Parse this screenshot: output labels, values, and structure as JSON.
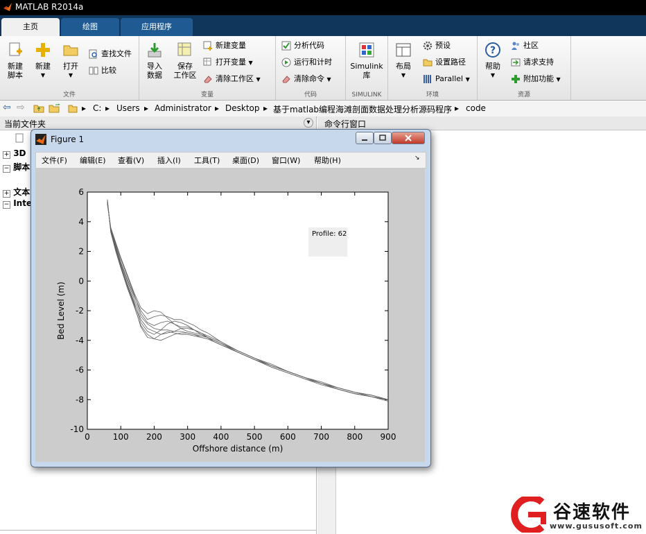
{
  "window": {
    "title": "MATLAB R2014a"
  },
  "tabs": [
    {
      "label": "主页",
      "active": true
    },
    {
      "label": "绘图",
      "active": false
    },
    {
      "label": "应用程序",
      "active": false
    }
  ],
  "ribbon": {
    "file": {
      "section_label": "文件",
      "new_script": "新建\n脚本",
      "new": "新建",
      "open": "打开",
      "find_files": "查找文件",
      "compare": "比较"
    },
    "variable": {
      "section_label": "变量",
      "import": "导入\n数据",
      "save_ws": "保存\n工作区",
      "new_var": "新建变量",
      "open_var": "打开变量",
      "clear_ws": "清除工作区"
    },
    "code": {
      "section_label": "代码",
      "analyze": "分析代码",
      "run_time": "运行和计时",
      "clear_cmd": "清除命令"
    },
    "simulink": {
      "section_label": "SIMULINK",
      "lib": "Simulink\n库"
    },
    "environment": {
      "section_label": "环境",
      "layout": "布局",
      "prefs": "预设",
      "set_path": "设置路径",
      "parallel": "Parallel"
    },
    "resources": {
      "section_label": "资源",
      "help": "帮助",
      "community": "社区",
      "request": "请求支持",
      "addons": "附加功能"
    }
  },
  "address": [
    "C:",
    "Users",
    "Administrator",
    "Desktop",
    "基于matlab编程海滩剖面数据处理分析源码程序",
    "code"
  ],
  "left_panel": {
    "header": "当前文件夹",
    "items": [
      {
        "sign": "+",
        "label": "3D"
      },
      {
        "sign": "−",
        "label": "脚本"
      },
      {
        "sign": "+",
        "label": "文本"
      },
      {
        "sign": "−",
        "label": "Inte"
      }
    ]
  },
  "right_panel": {
    "header": "命令行窗口"
  },
  "figure": {
    "title": "Figure 1",
    "menu": [
      "文件(F)",
      "编辑(E)",
      "查看(V)",
      "插入(I)",
      "工具(T)",
      "桌面(D)",
      "窗口(W)",
      "帮助(H)"
    ],
    "annotation": "Profile: 62"
  },
  "chart_data": {
    "type": "line",
    "xlabel": "Offshore distance (m)",
    "ylabel": "Bed Level (m)",
    "xlim": [
      0,
      900
    ],
    "ylim": [
      -10,
      6
    ],
    "xticks": [
      0,
      100,
      200,
      300,
      400,
      500,
      600,
      700,
      800,
      900
    ],
    "yticks": [
      -10,
      -8,
      -6,
      -4,
      -2,
      0,
      2,
      4,
      6
    ],
    "grid": false,
    "line_color": "#606060",
    "series": [
      {
        "x": [
          60,
          70,
          85,
          100,
          120,
          140,
          160,
          180,
          200,
          220,
          240,
          260,
          280,
          300,
          320,
          340,
          360,
          380,
          400,
          450,
          500,
          550,
          600,
          650,
          700,
          750,
          800,
          850,
          900
        ],
        "y": [
          5.3,
          3.5,
          2.3,
          1.2,
          0.0,
          -1.2,
          -2.4,
          -2.9,
          -3.2,
          -3.3,
          -3.3,
          -3.4,
          -3.4,
          -3.5,
          -3.6,
          -3.7,
          -3.8,
          -4.0,
          -4.2,
          -4.7,
          -5.2,
          -5.7,
          -6.1,
          -6.5,
          -6.9,
          -7.2,
          -7.5,
          -7.7,
          -8.0
        ]
      },
      {
        "x": [
          60,
          70,
          85,
          100,
          120,
          140,
          160,
          180,
          200,
          220,
          240,
          260,
          280,
          300,
          320,
          340,
          360,
          380,
          400,
          450,
          500,
          550,
          600,
          650,
          700,
          750,
          800,
          850,
          900
        ],
        "y": [
          5.4,
          3.4,
          2.1,
          1.0,
          -0.3,
          -1.5,
          -2.6,
          -3.2,
          -3.4,
          -3.6,
          -3.5,
          -3.4,
          -3.2,
          -3.2,
          -3.3,
          -3.5,
          -3.7,
          -3.9,
          -4.1,
          -4.7,
          -5.2,
          -5.7,
          -6.1,
          -6.5,
          -6.9,
          -7.3,
          -7.6,
          -7.8,
          -8.0
        ]
      },
      {
        "x": [
          60,
          70,
          85,
          100,
          120,
          140,
          160,
          180,
          200,
          220,
          240,
          260,
          280,
          300,
          320,
          340,
          360,
          380,
          400,
          450,
          500,
          550,
          600,
          650,
          700,
          750,
          800,
          850,
          900
        ],
        "y": [
          5.2,
          3.6,
          2.6,
          1.6,
          0.4,
          -0.8,
          -1.8,
          -2.2,
          -2.0,
          -2.1,
          -2.5,
          -2.9,
          -3.1,
          -3.1,
          -3.3,
          -3.5,
          -3.8,
          -4.1,
          -4.3,
          -4.8,
          -5.3,
          -5.7,
          -6.1,
          -6.5,
          -6.9,
          -7.2,
          -7.5,
          -7.8,
          -8.0
        ]
      },
      {
        "x": [
          60,
          70,
          85,
          100,
          120,
          140,
          160,
          180,
          200,
          220,
          240,
          260,
          280,
          300,
          320,
          340,
          360,
          380,
          400,
          450,
          500,
          550,
          600,
          650,
          700,
          750,
          800,
          850,
          900
        ],
        "y": [
          5.5,
          3.3,
          2.0,
          0.9,
          -0.5,
          -1.7,
          -3.0,
          -3.6,
          -3.9,
          -4.0,
          -3.8,
          -3.6,
          -3.5,
          -3.5,
          -3.6,
          -3.8,
          -3.9,
          -4.1,
          -4.3,
          -4.8,
          -5.3,
          -5.8,
          -6.2,
          -6.6,
          -6.9,
          -7.3,
          -7.6,
          -7.8,
          -8.1
        ]
      },
      {
        "x": [
          60,
          70,
          85,
          100,
          120,
          140,
          160,
          180,
          200,
          220,
          240,
          260,
          280,
          300,
          320,
          340,
          360,
          380,
          400,
          450,
          500,
          550,
          600,
          650,
          700,
          750,
          800,
          850,
          900
        ],
        "y": [
          5.3,
          3.5,
          2.4,
          1.3,
          0.1,
          -1.0,
          -2.0,
          -2.6,
          -2.4,
          -2.3,
          -2.4,
          -2.6,
          -2.6,
          -2.8,
          -3.0,
          -3.3,
          -3.5,
          -3.8,
          -4.1,
          -4.7,
          -5.2,
          -5.6,
          -6.1,
          -6.5,
          -6.8,
          -7.2,
          -7.5,
          -7.7,
          -8.0
        ]
      },
      {
        "x": [
          60,
          70,
          85,
          100,
          120,
          140,
          160,
          180,
          200,
          220,
          240,
          260,
          280,
          300,
          320,
          340,
          360,
          380,
          400,
          450,
          500,
          550,
          600,
          650,
          700,
          750,
          800,
          850,
          900
        ],
        "y": [
          5.4,
          3.4,
          2.2,
          1.1,
          -0.2,
          -1.4,
          -2.8,
          -3.4,
          -3.6,
          -3.3,
          -2.9,
          -2.7,
          -2.8,
          -3.0,
          -3.3,
          -3.6,
          -3.8,
          -4.0,
          -4.2,
          -4.7,
          -5.2,
          -5.7,
          -6.1,
          -6.5,
          -6.9,
          -7.2,
          -7.5,
          -7.7,
          -8.0
        ]
      },
      {
        "x": [
          60,
          70,
          85,
          100,
          120,
          140,
          160,
          180,
          200,
          220,
          240,
          260,
          280,
          300,
          320,
          340,
          360,
          380,
          400,
          450,
          500,
          550,
          600,
          650,
          700,
          750,
          800,
          850,
          900
        ],
        "y": [
          5.2,
          3.6,
          2.5,
          1.5,
          0.3,
          -0.9,
          -2.2,
          -2.8,
          -3.0,
          -2.8,
          -2.7,
          -2.9,
          -3.2,
          -3.4,
          -3.5,
          -3.6,
          -3.8,
          -4.0,
          -4.2,
          -4.8,
          -5.3,
          -5.7,
          -6.1,
          -6.5,
          -6.9,
          -7.3,
          -7.6,
          -7.8,
          -8.0
        ]
      },
      {
        "x": [
          60,
          70,
          85,
          100,
          120,
          140,
          160,
          180,
          200,
          220,
          240,
          260,
          280,
          300,
          320,
          340,
          360,
          380,
          400,
          450,
          500,
          550,
          600,
          650,
          700,
          750,
          800,
          850,
          900
        ],
        "y": [
          5.5,
          3.3,
          2.1,
          0.9,
          -0.4,
          -1.6,
          -3.1,
          -3.8,
          -3.9,
          -3.6,
          -3.4,
          -3.5,
          -3.6,
          -3.6,
          -3.7,
          -3.8,
          -3.9,
          -4.1,
          -4.3,
          -4.8,
          -5.3,
          -5.8,
          -6.2,
          -6.6,
          -7.0,
          -7.3,
          -7.6,
          -7.8,
          -8.1
        ]
      }
    ]
  },
  "watermark": {
    "text": "谷速软件",
    "url": "www.gususoft.com"
  }
}
